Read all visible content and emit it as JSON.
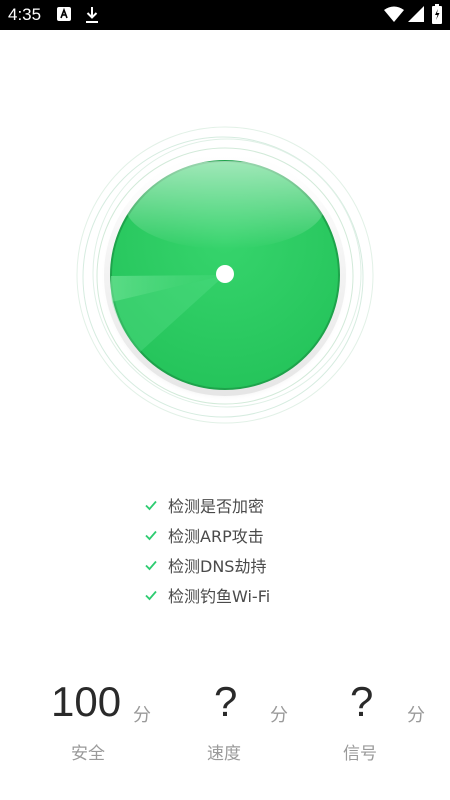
{
  "status_bar": {
    "time": "4:35",
    "icons": [
      "accessibility-icon",
      "download-icon",
      "wifi-icon",
      "signal-icon",
      "battery-charging-icon"
    ]
  },
  "scanner": {
    "state": "scanning",
    "colors": {
      "primary": "#2ecc63",
      "dark": "#1fa84a",
      "ring": "#d9eedf"
    }
  },
  "checklist": {
    "items": [
      {
        "label": "检测是否加密"
      },
      {
        "label": "检测ARP攻击"
      },
      {
        "label": "检测DNS劫持"
      },
      {
        "label": "检测钓鱼Wi-Fi"
      }
    ],
    "check_color": "#2ecc71"
  },
  "scores": [
    {
      "value": "100",
      "unit": "分",
      "label": "安全"
    },
    {
      "value": "?",
      "unit": "分",
      "label": "速度"
    },
    {
      "value": "?",
      "unit": "分",
      "label": "信号"
    }
  ]
}
